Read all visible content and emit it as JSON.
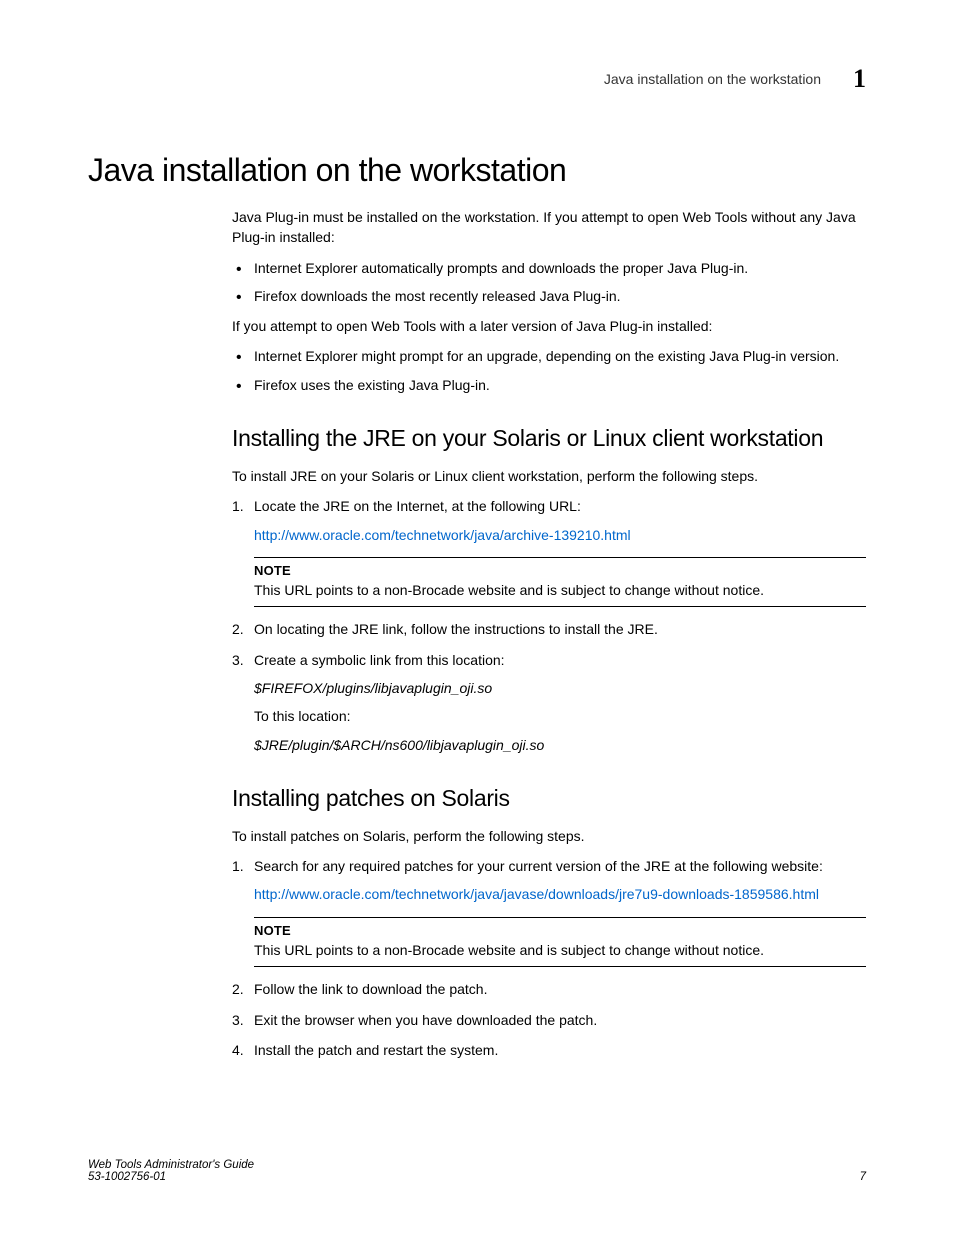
{
  "header": {
    "running_title": "Java installation on the workstation",
    "chapter_number": "1"
  },
  "h1": "Java installation on the workstation",
  "intro_p1": "Java Plug-in must be installed on the workstation. If you attempt to open Web Tools without any Java Plug-in installed:",
  "bullets1": [
    "Internet Explorer automatically prompts and downloads the proper Java Plug-in.",
    "Firefox downloads the most recently released Java Plug-in."
  ],
  "intro_p2": "If you attempt to open Web Tools with a later version of Java Plug-in installed:",
  "bullets2": [
    "Internet Explorer might prompt for an upgrade, depending on the existing Java Plug-in version.",
    "Firefox uses the existing Java Plug-in."
  ],
  "section2": {
    "heading": "Installing the JRE on your Solaris or Linux client workstation",
    "intro": "To install JRE on your Solaris or Linux client workstation, perform the following steps.",
    "step1": "Locate the JRE on the Internet, at the following URL:",
    "step1_link": "http://www.oracle.com/technetwork/java/archive-139210.html",
    "note_label": "NOTE",
    "note_text": "This URL points to a non-Brocade website and is subject to change without notice.",
    "step2": "On locating the JRE link, follow the instructions to install the JRE.",
    "step3": "Create a symbolic link from this location:",
    "step3_path1": "$FIREFOX/plugins/libjavaplugin_oji.so",
    "step3_mid": "To this location:",
    "step3_path2": "$JRE/plugin/$ARCH/ns600/libjavaplugin_oji.so"
  },
  "section3": {
    "heading": "Installing patches on Solaris",
    "intro": "To install patches on Solaris, perform the following steps.",
    "step1": "Search for any required patches for your current version of the JRE at the following website:",
    "step1_link": "http://www.oracle.com/technetwork/java/javase/downloads/jre7u9-downloads-1859586.html",
    "note_label": "NOTE",
    "note_text": "This URL points to a non-Brocade website and is subject to change without notice.",
    "step2": "Follow the link to download the patch.",
    "step3": "Exit the browser when you have downloaded the patch.",
    "step4": "Install the patch and restart the system."
  },
  "footer": {
    "title": "Web Tools Administrator's Guide",
    "docnum": "53-1002756-01",
    "page": "7"
  }
}
